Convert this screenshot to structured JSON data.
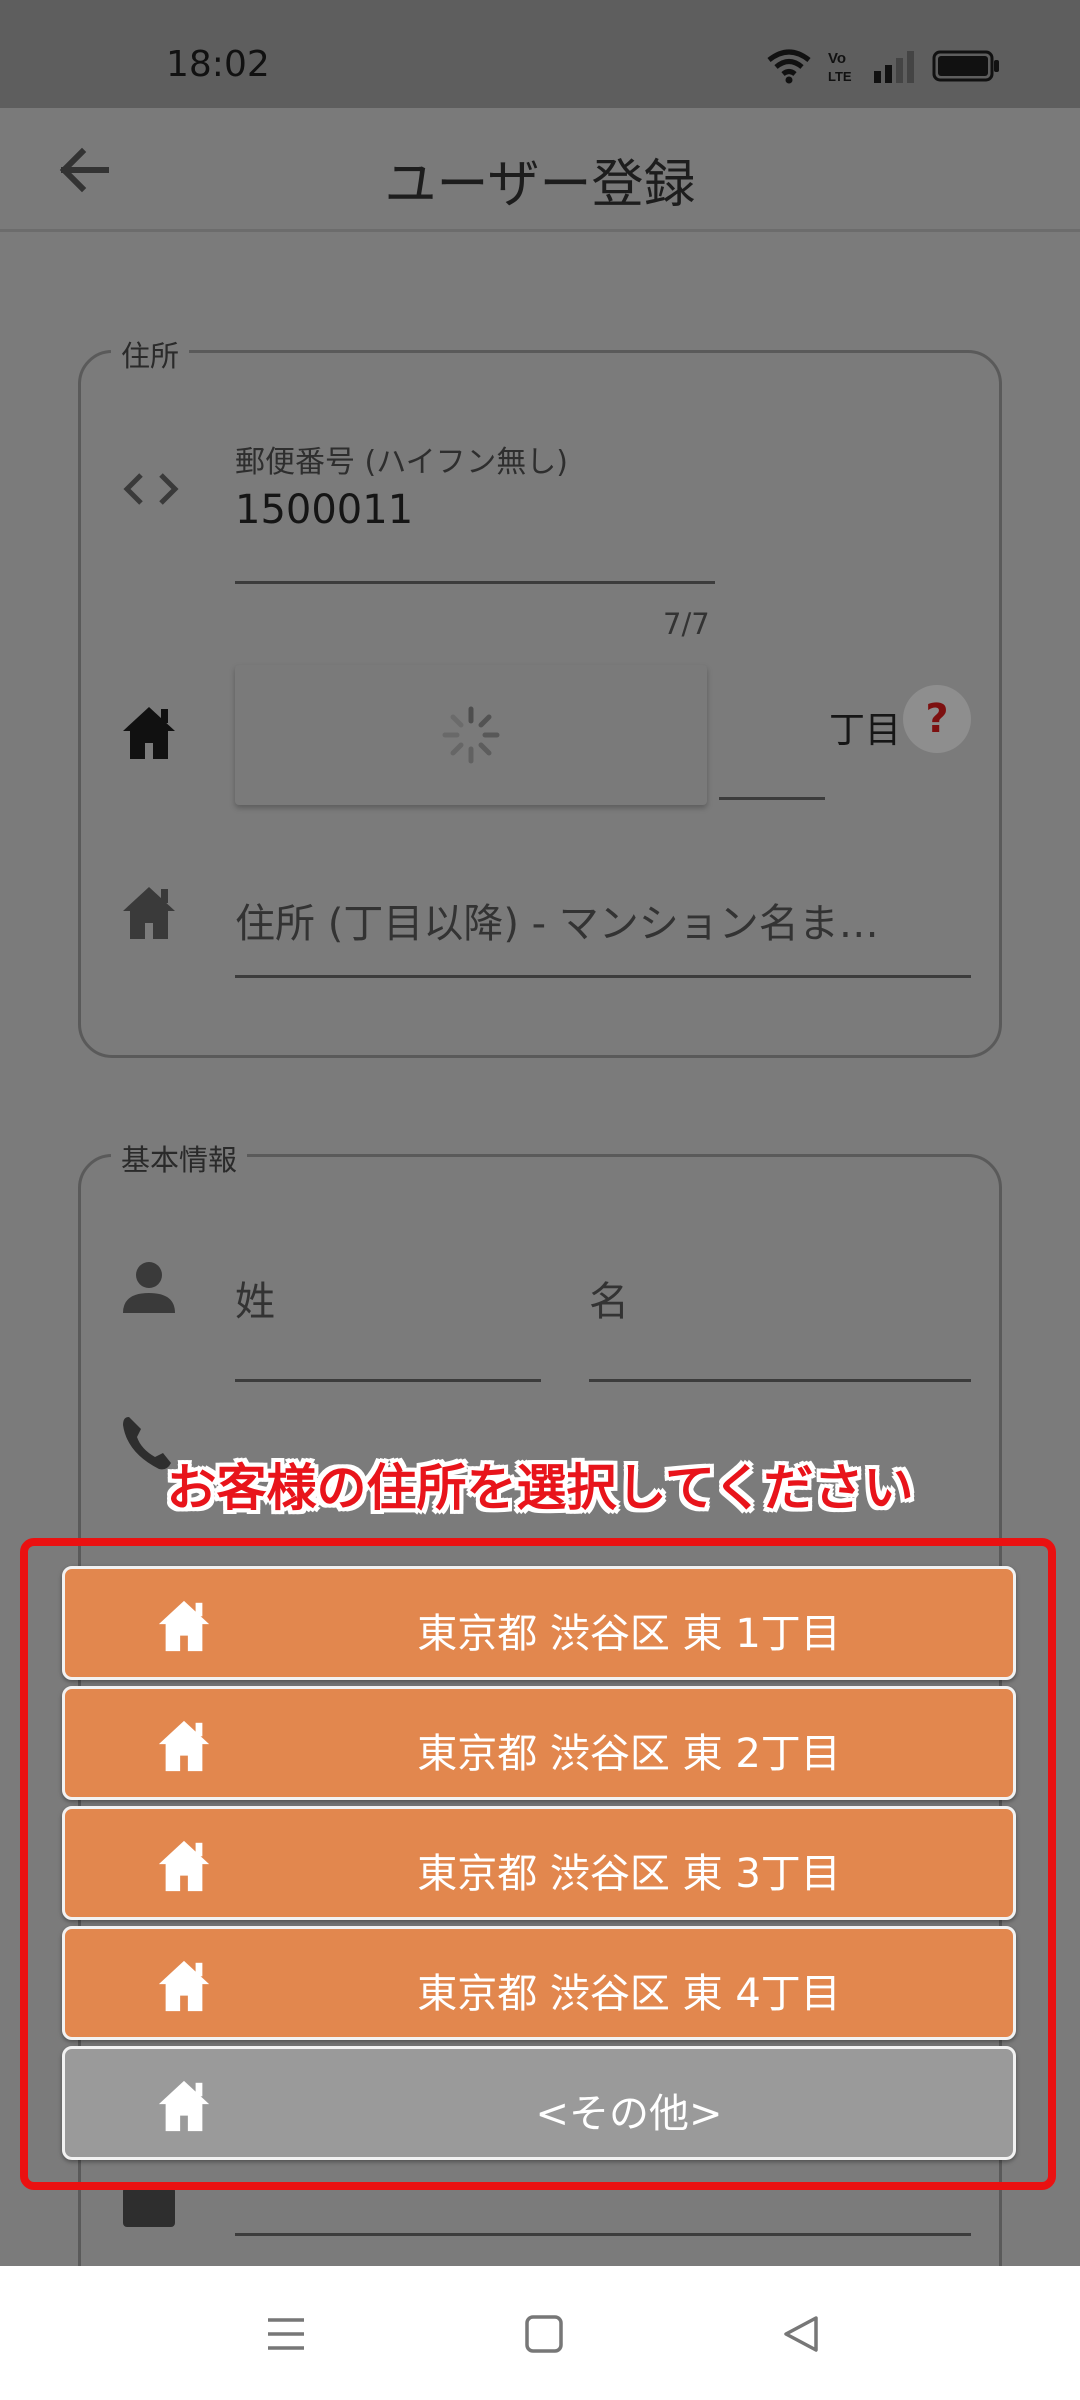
{
  "status_bar": {
    "time": "18:02",
    "icons": [
      "wifi-icon",
      "volte-icon",
      "signal-icon",
      "battery-icon"
    ],
    "volte_top": "Vo",
    "volte_bottom": "LTE"
  },
  "app_bar": {
    "title": "ユーザー登録",
    "back_icon": "arrow-left-icon"
  },
  "address_section": {
    "legend": "住所",
    "postal_code": {
      "label": "郵便番号 (ハイフン無し)",
      "value": "1500011",
      "counter": "7/7",
      "icon": "code-icon"
    },
    "prefecture_row": {
      "icon": "house-icon",
      "loading": true,
      "chome_label": "丁目",
      "help_symbol": "?"
    },
    "address_line": {
      "icon": "house-icon",
      "placeholder": "住所 (丁目以降) - マンション名ま…"
    }
  },
  "basic_section": {
    "legend": "基本情報",
    "last_name_placeholder": "姓",
    "first_name_placeholder": "名",
    "person_icon": "person-icon",
    "phone_icon": "phone-icon",
    "mail_icon": "mail-icon"
  },
  "selection_overlay": {
    "title": "お客様の住所を選択してください",
    "frame_color": "#ea1111",
    "options": [
      {
        "label": "東京都 渋谷区 東 1丁目",
        "style": "orange"
      },
      {
        "label": "東京都 渋谷区 東 2丁目",
        "style": "orange"
      },
      {
        "label": "東京都 渋谷区 東 3丁目",
        "style": "orange"
      },
      {
        "label": "東京都 渋谷区 東 4丁目",
        "style": "orange"
      },
      {
        "label": "<その他>",
        "style": "gray"
      }
    ],
    "option_colors": {
      "orange": "#e2874e",
      "gray": "#9a9a9a"
    }
  },
  "nav_bar": {
    "buttons": [
      "menu-icon",
      "home-square-icon",
      "back-triangle-icon"
    ]
  }
}
